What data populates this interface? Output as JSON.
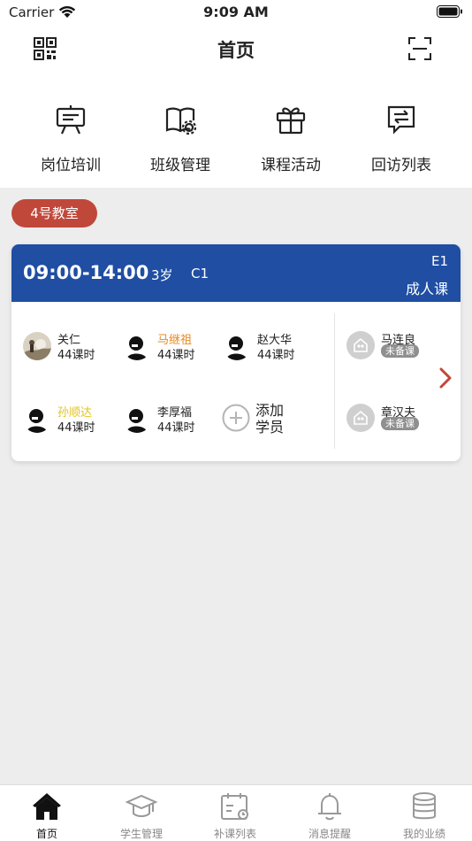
{
  "status": {
    "carrier": "Carrier",
    "time": "9:09 AM"
  },
  "nav": {
    "title": "首页"
  },
  "quick_menu": [
    {
      "label": "岗位培训",
      "icon": "training-board-icon"
    },
    {
      "label": "班级管理",
      "icon": "class-book-icon"
    },
    {
      "label": "课程活动",
      "icon": "gift-icon"
    },
    {
      "label": "回访列表",
      "icon": "feedback-chat-icon"
    }
  ],
  "classroom": {
    "badge": "4号教室"
  },
  "course": {
    "time": "09:00-14:00",
    "age": "3岁",
    "level": "C1",
    "code": "E1",
    "type": "成人课",
    "students": [
      {
        "name": "关仁",
        "hours": "44课时",
        "name_color": "#222222"
      },
      {
        "name": "马继祖",
        "hours": "44课时",
        "name_color": "#e8891c"
      },
      {
        "name": "赵大华",
        "hours": "44课时",
        "name_color": "#222222"
      },
      {
        "name": "孙顺达",
        "hours": "44课时",
        "name_color": "#e3c41a"
      },
      {
        "name": "李厚福",
        "hours": "44课时",
        "name_color": "#222222"
      }
    ],
    "add_student": "添加\n学员",
    "teachers": [
      {
        "name": "马连良",
        "tag": "未备课"
      },
      {
        "name": "章汉夫",
        "tag": "未备课"
      }
    ]
  },
  "colors": {
    "accent": "#1f4ea3",
    "badge": "#c0483a",
    "arrow": "#c0483a"
  },
  "tabs": [
    {
      "label": "首页",
      "icon": "home-icon",
      "active": true
    },
    {
      "label": "学生管理",
      "icon": "graduation-cap-icon",
      "active": false
    },
    {
      "label": "补课列表",
      "icon": "calendar-icon",
      "active": false
    },
    {
      "label": "消息提醒",
      "icon": "bell-icon",
      "active": false
    },
    {
      "label": "我的业绩",
      "icon": "database-icon",
      "active": false
    }
  ]
}
